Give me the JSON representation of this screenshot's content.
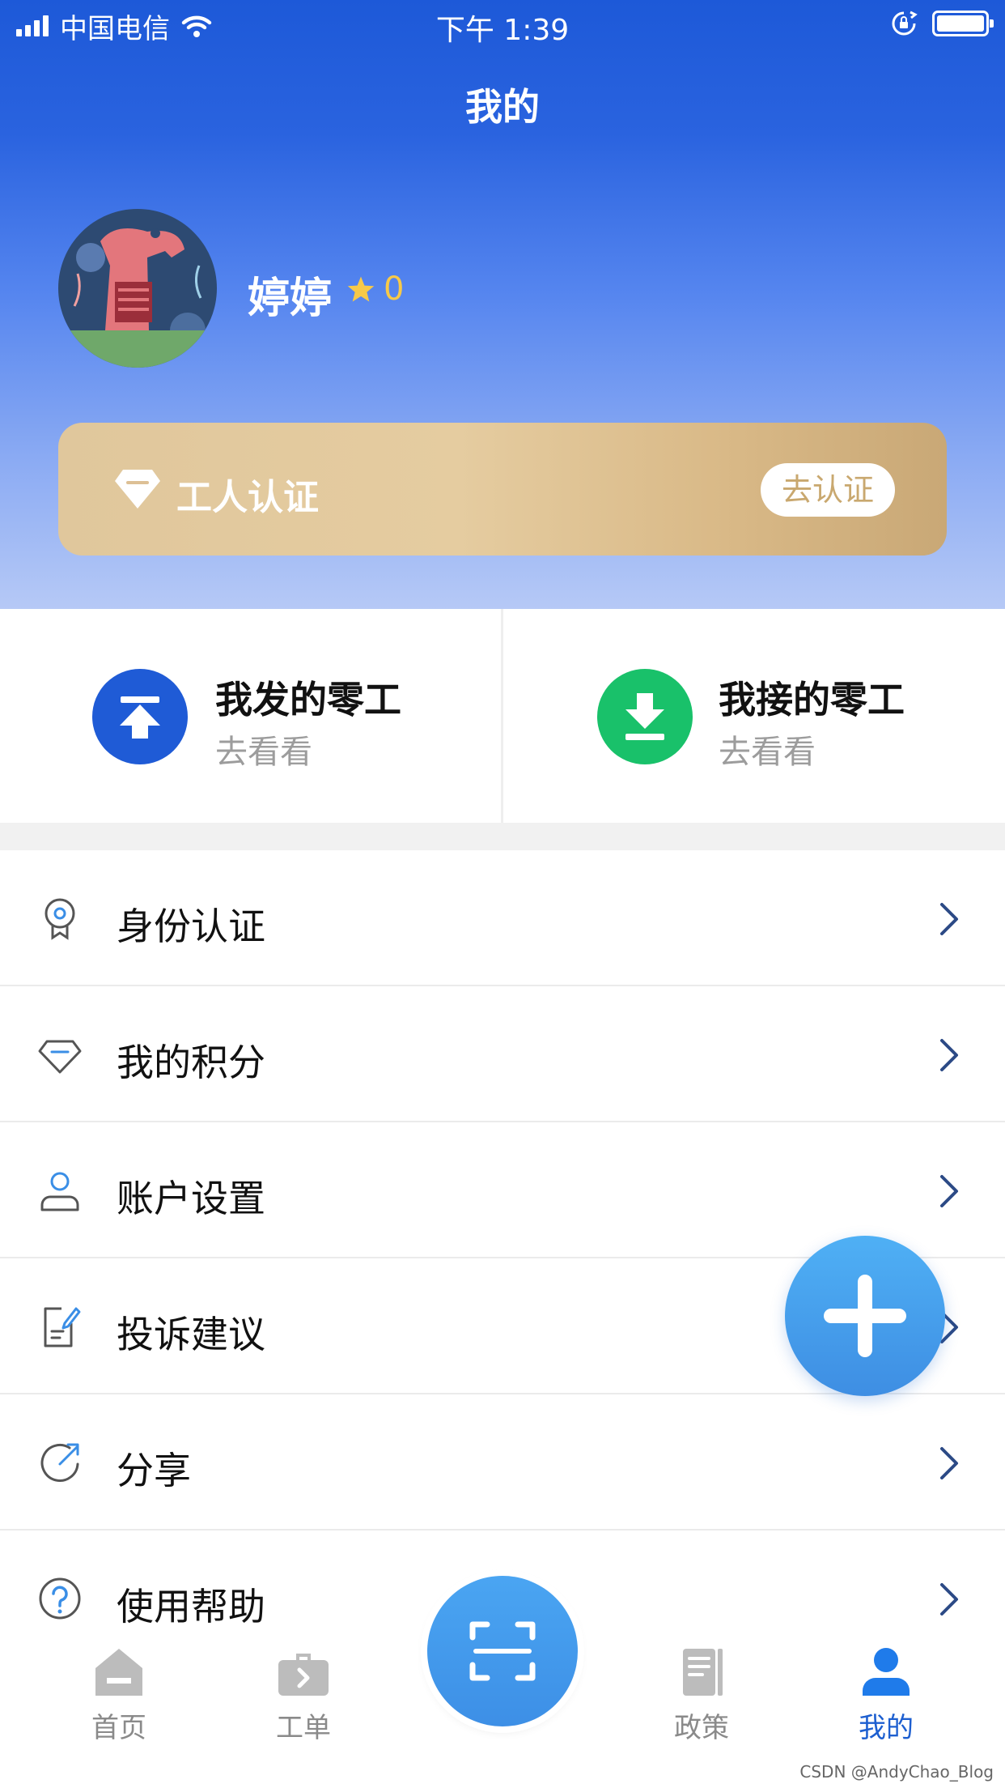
{
  "status_bar": {
    "carrier": "中国电信",
    "time": "下午 1:39"
  },
  "header": {
    "title": "我的"
  },
  "profile": {
    "name": "婷婷",
    "points": "0"
  },
  "certification": {
    "label": "工人认证",
    "button": "去认证"
  },
  "jobs": [
    {
      "title": "我发的零工",
      "subtitle": "去看看",
      "icon": "upload-icon",
      "color": "#1f5bd6"
    },
    {
      "title": "我接的零工",
      "subtitle": "去看看",
      "icon": "download-icon",
      "color": "#19c16a"
    }
  ],
  "menu": [
    {
      "label": "身份认证",
      "icon": "badge-icon"
    },
    {
      "label": "我的积分",
      "icon": "diamond-icon"
    },
    {
      "label": "账户设置",
      "icon": "user-icon"
    },
    {
      "label": "投诉建议",
      "icon": "document-edit-icon"
    },
    {
      "label": "分享",
      "icon": "share-icon"
    },
    {
      "label": "使用帮助",
      "icon": "help-icon"
    }
  ],
  "tab_bar": {
    "items": [
      {
        "label": "首页",
        "icon": "home-icon",
        "active": false
      },
      {
        "label": "工单",
        "icon": "briefcase-icon",
        "active": false
      },
      {
        "label": "政策",
        "icon": "book-icon",
        "active": false
      },
      {
        "label": "我的",
        "icon": "profile-icon",
        "active": true
      }
    ],
    "center_button_icon": "scan-icon"
  },
  "watermark": "CSDN @AndyChao_Blog",
  "colors": {
    "header_blue": "#1d59d8",
    "gold_card": "#e0c79c",
    "accent_blue": "#1d5fd0",
    "green": "#19c16a",
    "star": "#f7c948",
    "fab_blue": "#4aa5f2"
  }
}
